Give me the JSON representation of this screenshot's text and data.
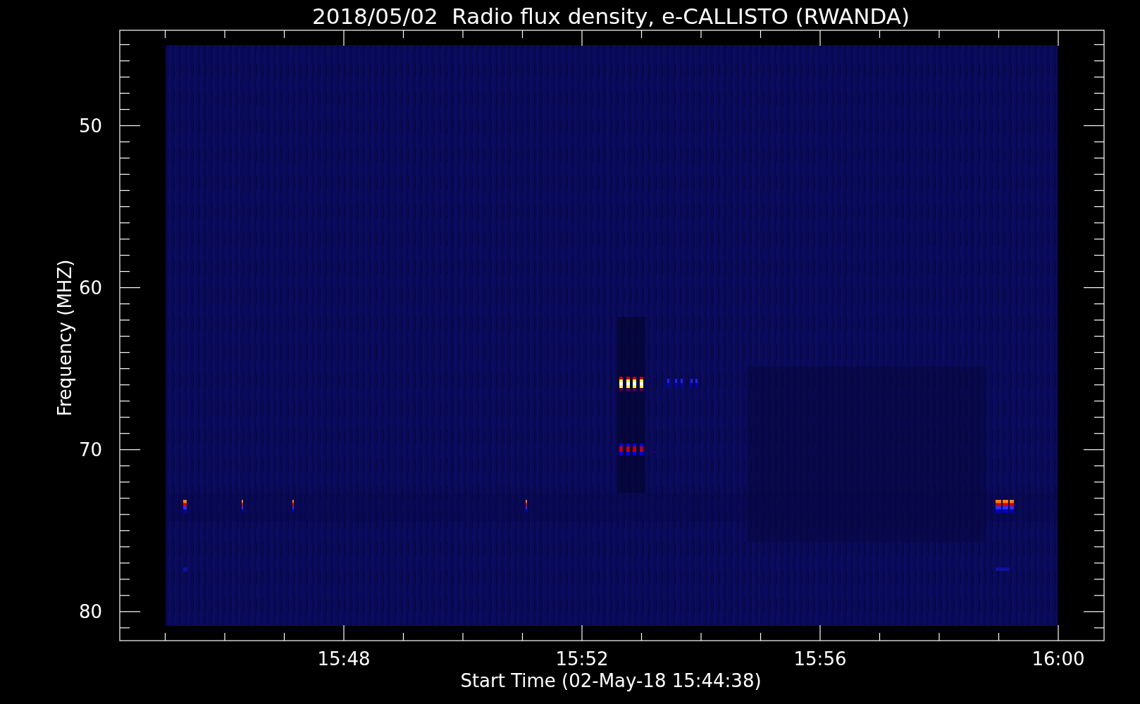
{
  "title": "2018/05/02  Radio flux density, e-CALLISTO (RWANDA)",
  "y_axis": {
    "label": "Frequency (MHZ)",
    "ticks": [
      "50",
      "60",
      "70",
      "80"
    ]
  },
  "x_axis": {
    "label": "Start Time (02-May-18 15:44:38)",
    "ticks": [
      "15:48",
      "15:52",
      "15:56",
      "16:00"
    ]
  }
}
